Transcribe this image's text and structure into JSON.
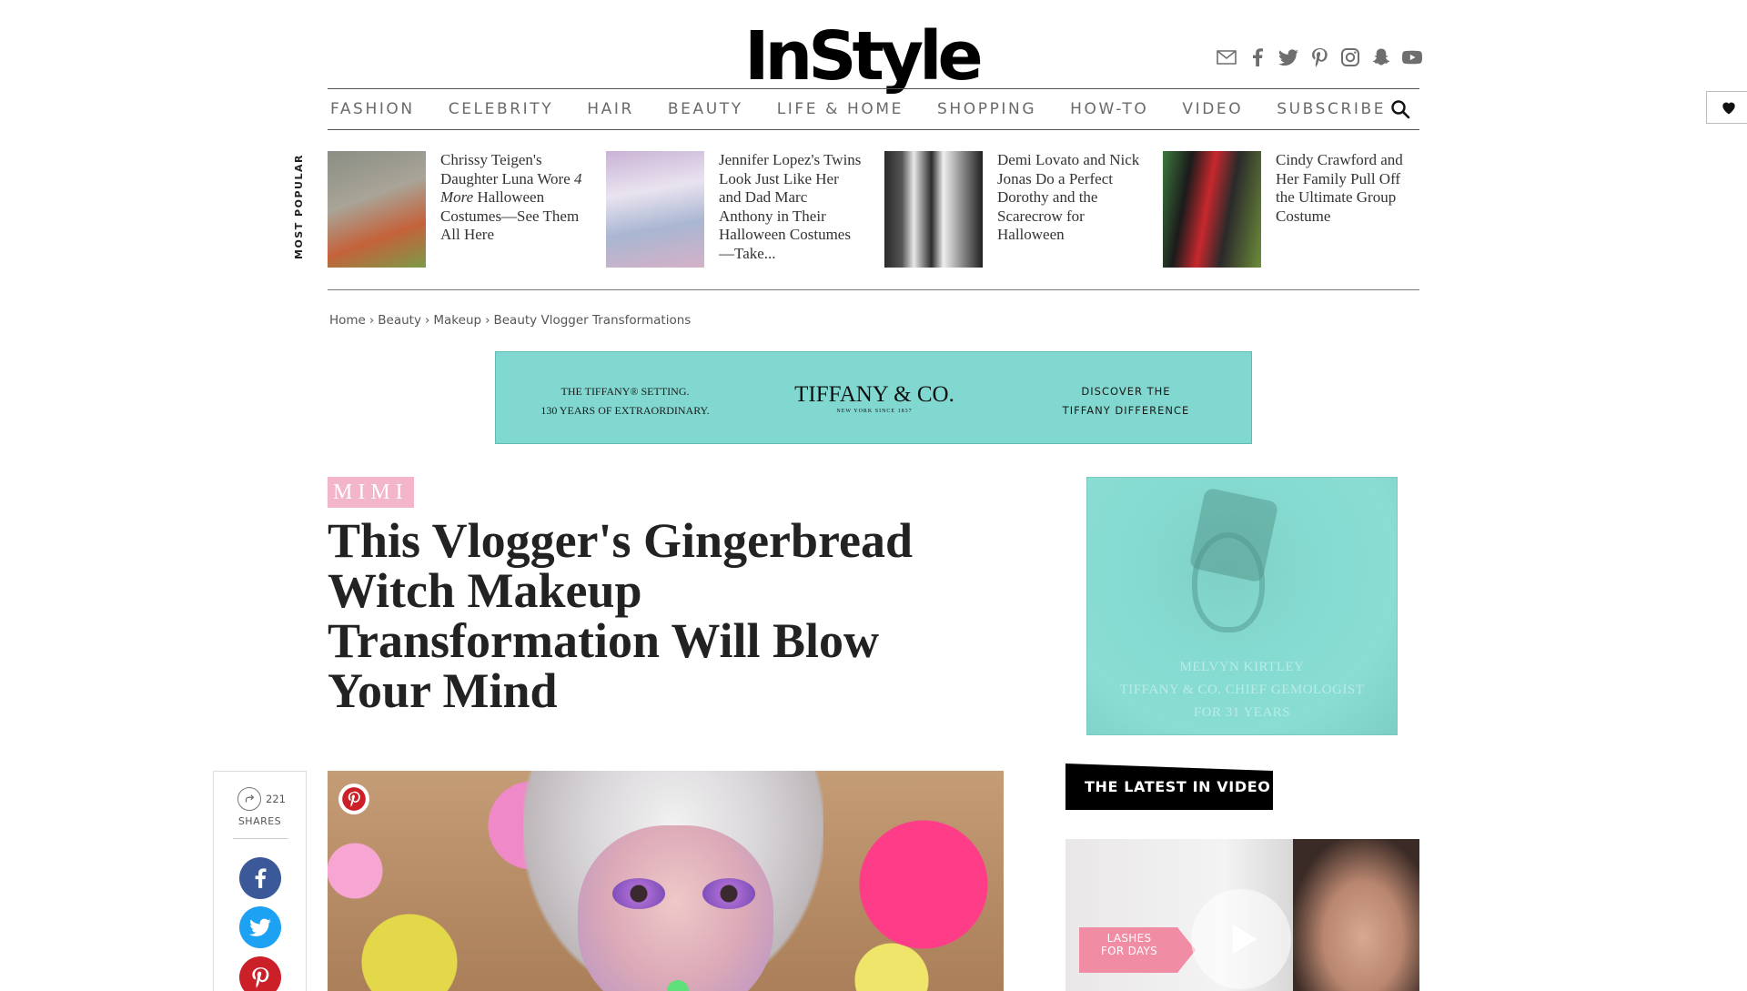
{
  "header": {
    "logo_text": "InStyle",
    "social_icons": [
      "mail-icon",
      "facebook-icon",
      "twitter-icon",
      "pinterest-icon",
      "instagram-icon",
      "snapchat-icon",
      "youtube-icon"
    ]
  },
  "nav": {
    "items": [
      "FASHION",
      "CELEBRITY",
      "HAIR",
      "BEAUTY",
      "LIFE & HOME",
      "SHOPPING",
      "HOW-TO",
      "VIDEO",
      "SUBSCRIBE"
    ]
  },
  "most_popular": {
    "label": "MOST POPULAR",
    "items": [
      {
        "title_before": "Chrissy Teigen's Daughter Luna Wore ",
        "title_em": "4 More",
        "title_after": " Halloween Costumes—See Them All Here"
      },
      {
        "title": "Jennifer Lopez's Twins Look Just Like Her and Dad Marc Anthony in Their Halloween Costumes—Take..."
      },
      {
        "title": "Demi Lovato and Nick Jonas Do a Perfect Dorothy and the Scarecrow for Halloween"
      },
      {
        "title": "Cindy Crawford and Her Family Pull Off the Ultimate Group Costume"
      }
    ]
  },
  "breadcrumb": [
    "Home",
    "Beauty",
    "Makeup",
    "Beauty Vlogger Transformations"
  ],
  "banner_ad": {
    "left_line1": "THE TIFFANY® SETTING.",
    "left_line2": "130 YEARS OF EXTRAORDINARY.",
    "brand": "TIFFANY & CO.",
    "brand_sub": "NEW YORK SINCE 1837",
    "right_line1": "DISCOVER THE",
    "right_line2": "TIFFANY DIFFERENCE"
  },
  "article": {
    "tag": "MIMI",
    "headline": "This Vlogger's Gingerbread Witch Makeup Transformation Will Blow Your Mind"
  },
  "side_ad": {
    "line1": "MELVYN KIRTLEY",
    "line2": "TIFFANY & CO. CHIEF GEMOLOGIST",
    "line3": "FOR 31 YEARS"
  },
  "share": {
    "count": "221",
    "label": "SHARES",
    "buttons": [
      "facebook-icon",
      "twitter-icon",
      "pinterest-icon"
    ]
  },
  "latest_video": {
    "heading": "THE LATEST IN VIDEO",
    "overlay_line1": "LASHES",
    "overlay_line2": "FOR DAYS"
  },
  "colors": {
    "tiffany_blue": "#81d8d0",
    "tag_pink": "#f3b5c9",
    "facebook": "#3b5998",
    "twitter": "#1da1f2",
    "pinterest": "#cb2027"
  }
}
